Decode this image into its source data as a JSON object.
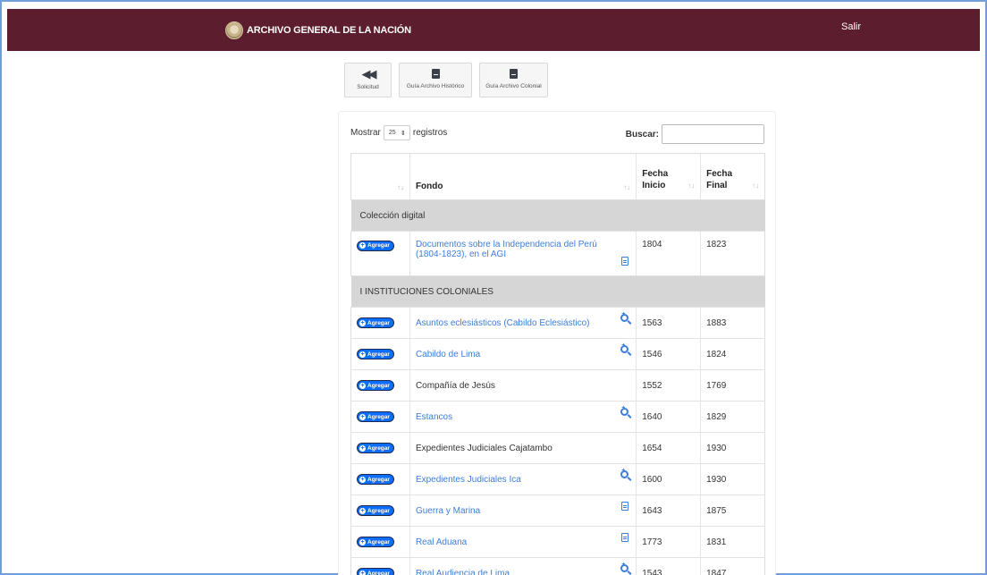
{
  "header": {
    "title": "ARCHIVO GENERAL DE LA NACIÓN",
    "logout_label": "Salir",
    "background": "#5c1d2e"
  },
  "nav": {
    "solicitud": "Solicitud",
    "guia_historico": "Guía Archivo Histórico",
    "guia_colonial": "Guía Archivo Colonial"
  },
  "controls": {
    "show_label": "Mostrar",
    "page_size": "25",
    "records_label": "registros",
    "search_label": "Buscar:",
    "search_value": ""
  },
  "table": {
    "col_fondo": "Fondo",
    "col_inicio_1": "Fecha",
    "col_inicio_2": "Inicio",
    "col_final_1": "Fecha",
    "col_final_2": "Final",
    "add_label": "Agregar",
    "groups": [
      {
        "name": "Colección digital",
        "rows": [
          {
            "fondo": "Documentos sobre la Independencia del Perú (1804-1823), en el AGI",
            "linked": true,
            "icon": "document-icon",
            "inicio": "1804",
            "final": "1823",
            "tall": true
          }
        ]
      },
      {
        "name": "I INSTITUCIONES COLONIALES",
        "rows": [
          {
            "fondo": "Asuntos eclesiásticos (Cabildo Eclesiástico)",
            "linked": true,
            "icon": "zoom-in-icon",
            "inicio": "1563",
            "final": "1883"
          },
          {
            "fondo": "Cabildo de Lima",
            "linked": true,
            "icon": "zoom-in-icon",
            "inicio": "1546",
            "final": "1824"
          },
          {
            "fondo": "Compañía de Jesús",
            "linked": false,
            "icon": "",
            "inicio": "1552",
            "final": "1769"
          },
          {
            "fondo": "Estancos",
            "linked": true,
            "icon": "zoom-in-icon",
            "inicio": "1640",
            "final": "1829"
          },
          {
            "fondo": "Expedientes Judiciales Cajatambo",
            "linked": false,
            "icon": "",
            "inicio": "1654",
            "final": "1930"
          },
          {
            "fondo": "Expedientes Judiciales Ica",
            "linked": true,
            "icon": "zoom-in-icon",
            "inicio": "1600",
            "final": "1930"
          },
          {
            "fondo": "Guerra y Marina",
            "linked": true,
            "icon": "document-icon",
            "inicio": "1643",
            "final": "1875"
          },
          {
            "fondo": "Real Aduana",
            "linked": true,
            "icon": "document-icon",
            "inicio": "1773",
            "final": "1831"
          },
          {
            "fondo": "Real Audiencia de Lima",
            "linked": true,
            "icon": "zoom-in-icon",
            "inicio": "1543",
            "final": "1847"
          }
        ]
      }
    ]
  }
}
